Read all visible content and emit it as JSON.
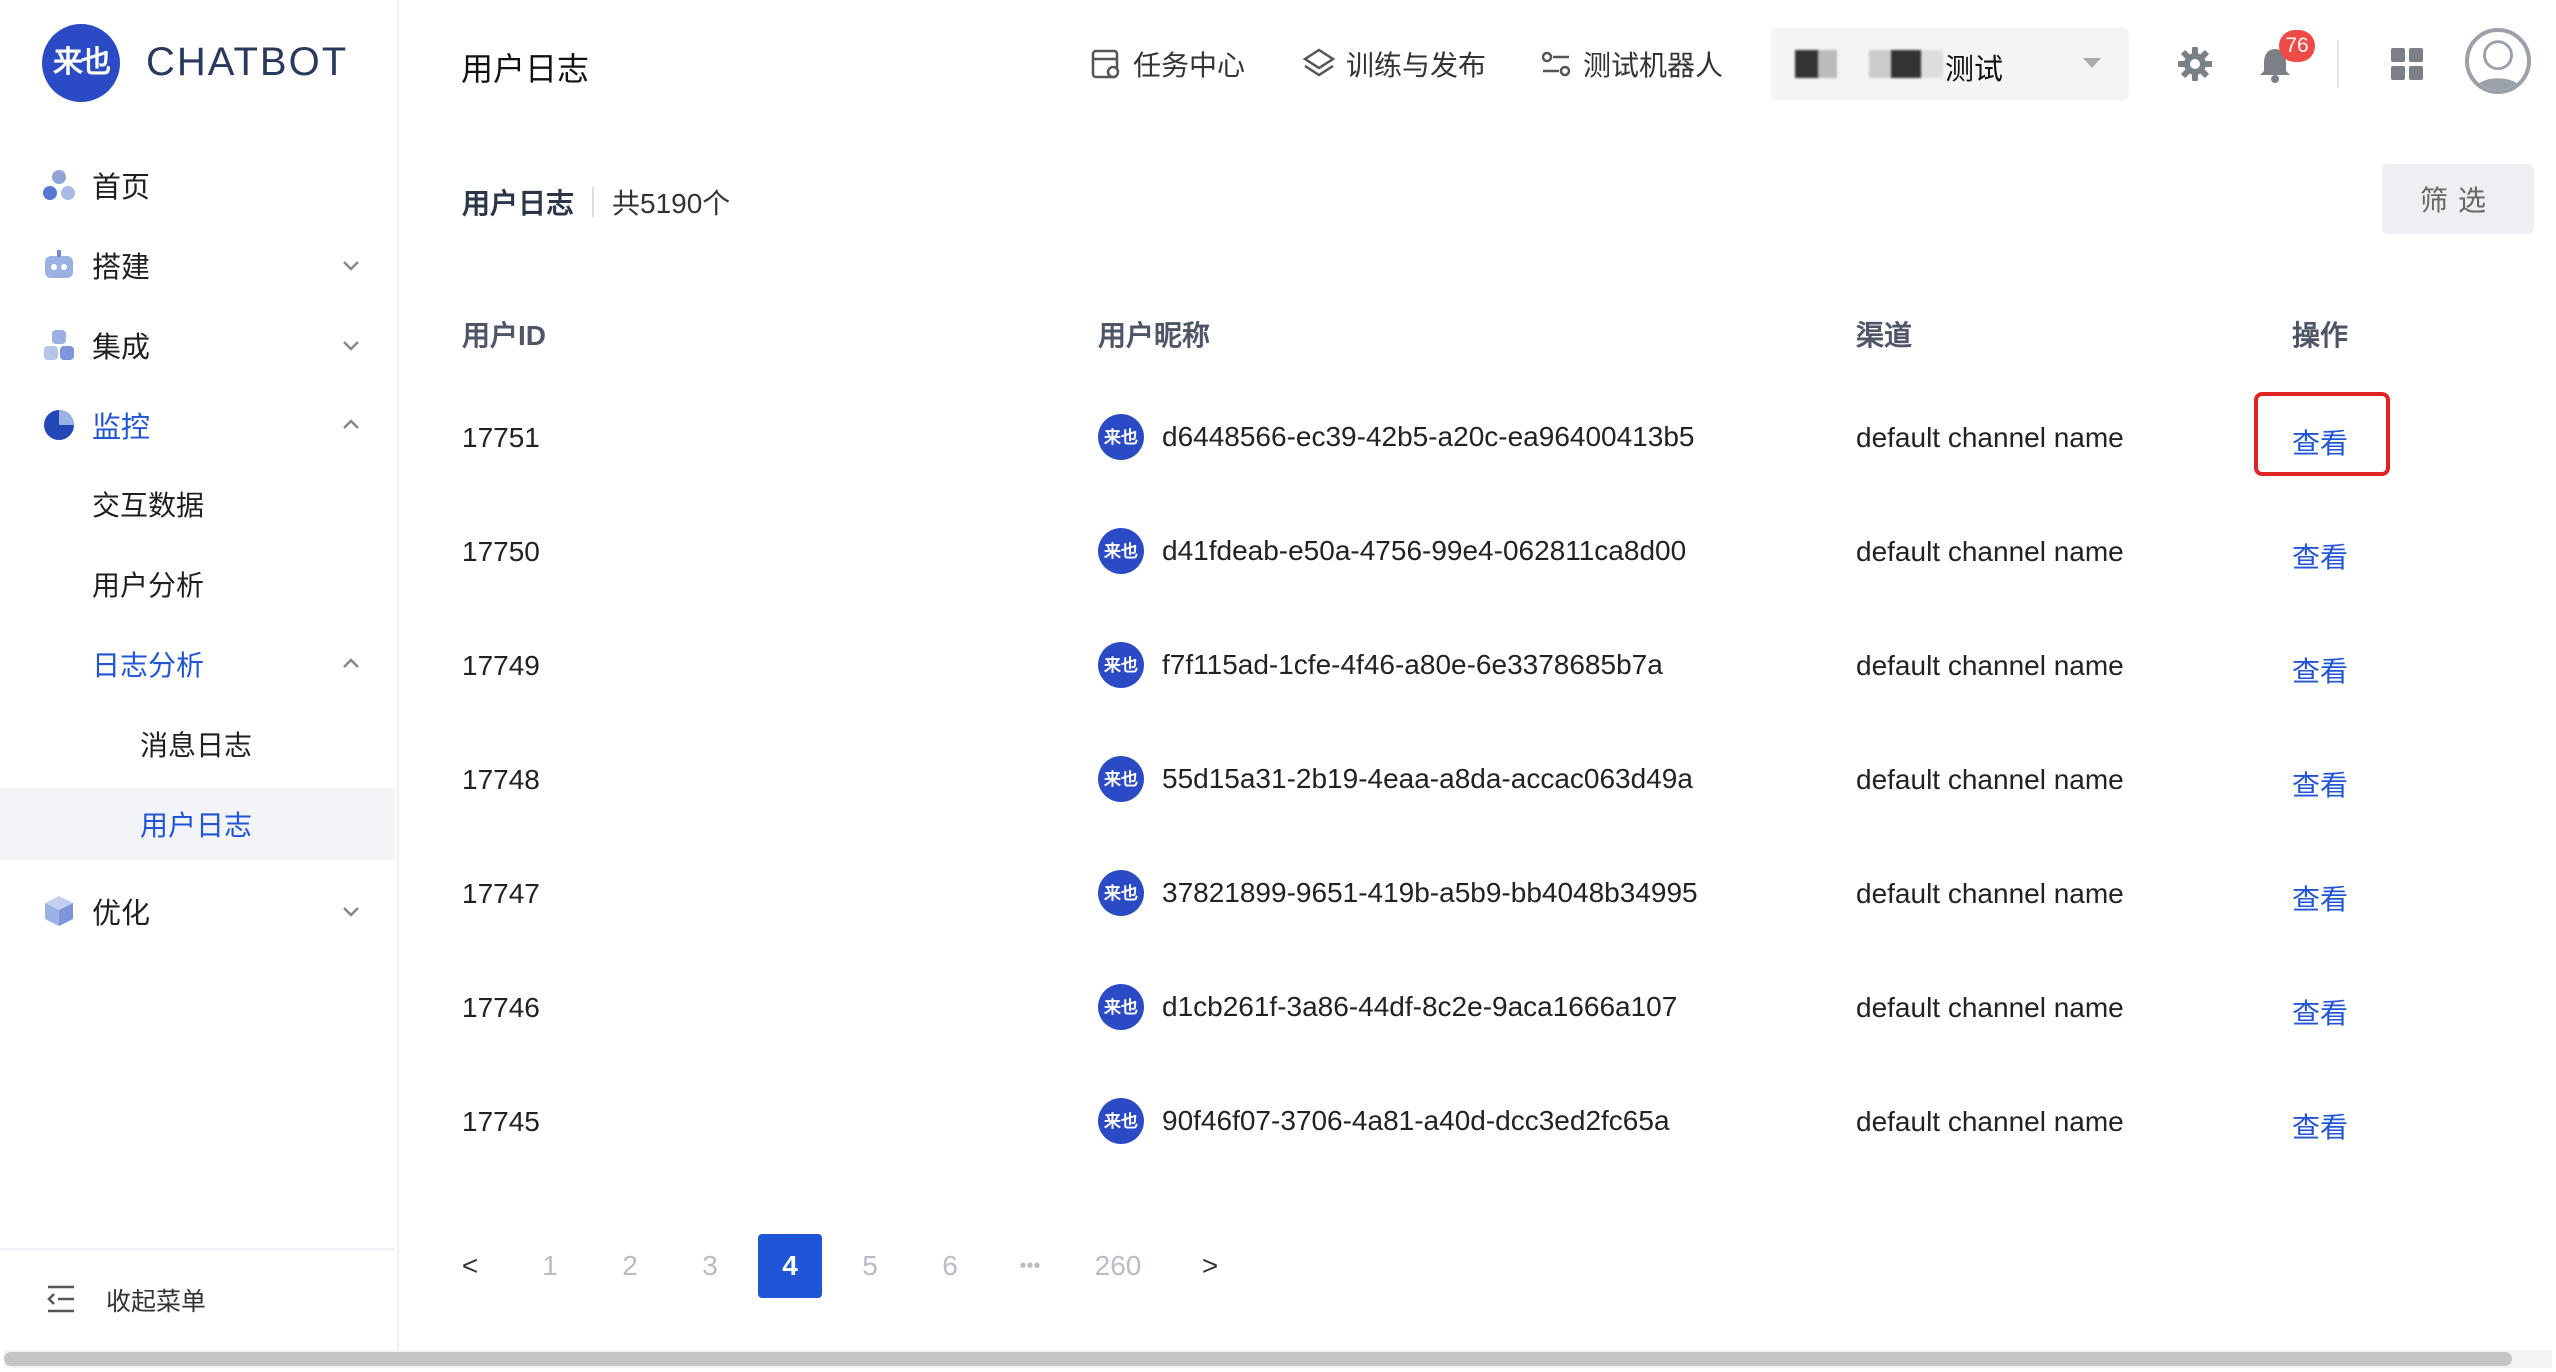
{
  "brand": {
    "logo_glyph": "来也",
    "name": "CHATBOT",
    "color": "#2b4bc6"
  },
  "sidebar": {
    "items": [
      {
        "label": "首页"
      },
      {
        "label": "搭建"
      },
      {
        "label": "集成"
      },
      {
        "label": "监控"
      },
      {
        "label": "交互数据"
      },
      {
        "label": "用户分析"
      },
      {
        "label": "日志分析"
      },
      {
        "label": "消息日志"
      },
      {
        "label": "用户日志"
      },
      {
        "label": "优化"
      }
    ],
    "collapse_label": "收起菜单"
  },
  "header": {
    "title": "用户日志",
    "links": [
      {
        "label": "任务中心",
        "icon": "task-center-icon"
      },
      {
        "label": "训练与发布",
        "icon": "train-publish-icon"
      },
      {
        "label": "测试机器人",
        "icon": "test-bot-icon"
      }
    ],
    "bot_select": {
      "value": "测试"
    },
    "notifications": {
      "count": "76"
    }
  },
  "content": {
    "title": "用户日志",
    "count": "共5190个",
    "filter_label": "筛选",
    "columns": [
      "用户ID",
      "用户昵称",
      "渠道",
      "操作"
    ],
    "rows": [
      {
        "id": "17751",
        "nickname": "d6448566-ec39-42b5-a20c-ea96400413b5",
        "channel": "default channel name",
        "action": "查看"
      },
      {
        "id": "17750",
        "nickname": "d41fdeab-e50a-4756-99e4-062811ca8d00",
        "channel": "default channel name",
        "action": "查看"
      },
      {
        "id": "17749",
        "nickname": "f7f115ad-1cfe-4f46-a80e-6e3378685b7a",
        "channel": "default channel name",
        "action": "查看"
      },
      {
        "id": "17748",
        "nickname": "55d15a31-2b19-4eaa-a8da-accac063d49a",
        "channel": "default channel name",
        "action": "查看"
      },
      {
        "id": "17747",
        "nickname": "37821899-9651-419b-a5b9-bb4048b34995",
        "channel": "default channel name",
        "action": "查看"
      },
      {
        "id": "17746",
        "nickname": "d1cb261f-3a86-44df-8c2e-9aca1666a107",
        "channel": "default channel name",
        "action": "查看"
      },
      {
        "id": "17745",
        "nickname": "90f46f07-3706-4a81-a40d-dcc3ed2fc65a",
        "channel": "default channel name",
        "action": "查看"
      }
    ],
    "avatar_glyph": "来也"
  },
  "pagination": {
    "prev": "<",
    "pages": [
      "1",
      "2",
      "3",
      "4",
      "5",
      "6"
    ],
    "ellipsis": "•••",
    "last": "260",
    "next": ">",
    "current": "4"
  },
  "colors": {
    "accent": "#1f55d6",
    "highlight": "#e02424",
    "badge": "#f04a46"
  }
}
